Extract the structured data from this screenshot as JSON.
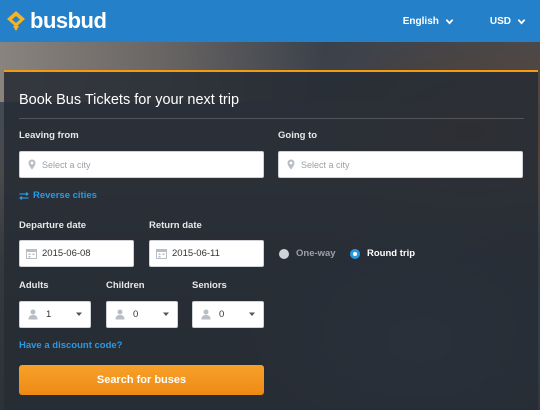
{
  "header": {
    "brand": "busbud",
    "language": "English",
    "currency": "USD"
  },
  "form": {
    "title": "Book Bus Tickets for your next trip",
    "leaving_from": {
      "label": "Leaving from",
      "placeholder": "Select a city"
    },
    "going_to": {
      "label": "Going to",
      "placeholder": "Select a city"
    },
    "reverse_label": "Reverse cities",
    "departure": {
      "label": "Departure date",
      "value": "2015-06-08"
    },
    "return": {
      "label": "Return date",
      "value": "2015-06-11"
    },
    "trip_type": {
      "one_way": "One-way",
      "round_trip": "Round trip",
      "selected": "round_trip"
    },
    "adults": {
      "label": "Adults",
      "value": "1"
    },
    "children": {
      "label": "Children",
      "value": "0"
    },
    "seniors": {
      "label": "Seniors",
      "value": "0"
    },
    "discount_link": "Have a discount code?",
    "search_button": "Search for buses"
  },
  "colors": {
    "header_bg": "#2481c9",
    "accent": "#f39c12",
    "link": "#2a9ae0",
    "button": "#ee8a14"
  },
  "icons": [
    "busbud-logo-icon",
    "chevron-down-icon",
    "map-pin-icon",
    "swap-icon",
    "calendar-icon",
    "user-icon"
  ]
}
